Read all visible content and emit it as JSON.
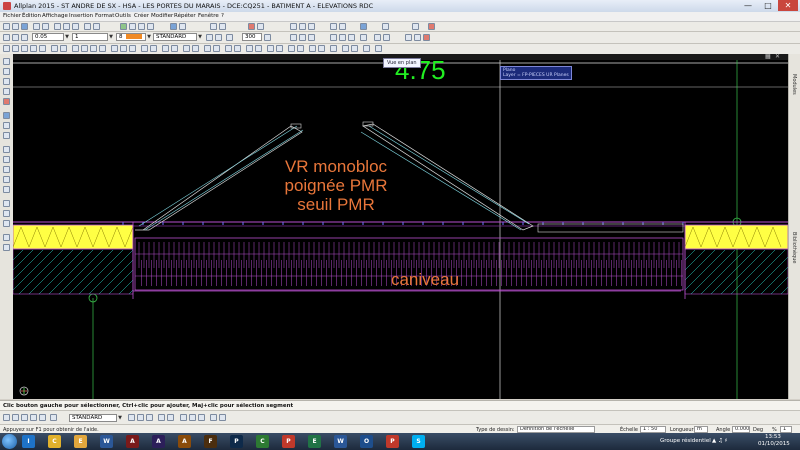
{
  "window": {
    "title": "Allplan 2015 - ST ANDRE DE SX - HSA - LES PORTES DU MARAIS - DCE:CQ251 - BATIMENT A - ELEVATIONS RDC"
  },
  "menu": {
    "items": [
      "Fichier",
      "Édition",
      "Affichage",
      "Insertion",
      "Format",
      "Outils",
      "Créer",
      "Modifier",
      "Répéter",
      "Fenêtre",
      "?"
    ]
  },
  "format_toolbar": {
    "pen": "0.05",
    "line": "1",
    "color": "8",
    "color_hex": "#f08a24",
    "layer": "STANDARD",
    "scale_field": "300"
  },
  "drawing": {
    "dimension": "4.75",
    "label_lines": [
      "VR monobloc",
      "poignée PMR",
      "seuil PMR"
    ],
    "label_caniveau": "caniveau",
    "tooltip": "Vue en plan",
    "info_lines": [
      "Plano",
      "Layer = FP-PIECES UR Planes"
    ]
  },
  "right_panel": {
    "tabs": [
      "Modules",
      "Bibliothèque"
    ]
  },
  "status": {
    "message": "Clic bouton gauche pour sélectionner, Ctrl+clic pour ajouter, Maj+clic pour sélection segment"
  },
  "bottom_toolbar": {
    "layer": "STANDARD"
  },
  "info_bar": {
    "help": "Appuyez sur F1 pour obtenir de l'aide.",
    "type_label": "Type de dessin:",
    "type_value": "Définition de l'échelle",
    "scale_label": "Échelle",
    "scale_value": "1 : 50",
    "length_label": "Longueur",
    "length_value": "m",
    "angle_label": "Angle",
    "angle_value": "0.000",
    "angle_unit": "Deg",
    "percent_label": "%",
    "percent_value": "1"
  },
  "taskbar": {
    "apps": [
      "IE",
      "Chrome",
      "Explorer",
      "Word",
      "Allplan",
      "Ae",
      "Ai",
      "Fw",
      "Ps",
      "Calc",
      "PDF",
      "Excel",
      "Word2",
      "Outlook",
      "PDF2",
      "Skype"
    ],
    "tray_label": "Groupe résidentiel",
    "time": "13:53",
    "date": "01/10/2015"
  },
  "colors": {
    "dimension": "#22ee22",
    "label": "#e8763a",
    "insulation": "#ffff44",
    "structure": "#b84fcf",
    "grid": "#4ad35a"
  }
}
